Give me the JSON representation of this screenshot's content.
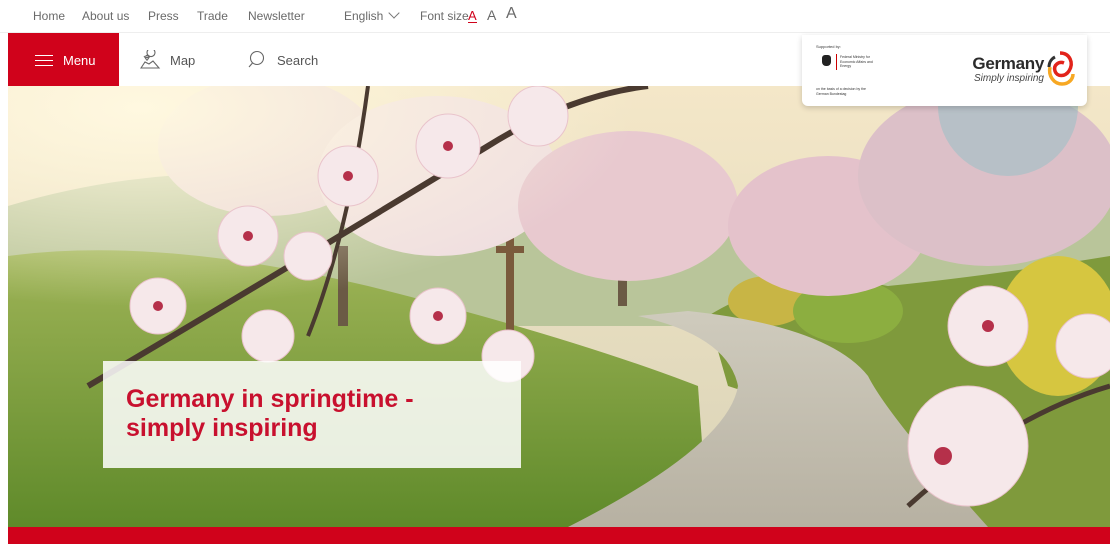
{
  "topbar": {
    "links": [
      "Home",
      "About us",
      "Press",
      "Trade",
      "Newsletter"
    ],
    "language": "English",
    "font_size_label": "Font size",
    "font_sizes": [
      "A",
      "A",
      "A"
    ]
  },
  "nav": {
    "menu_label": "Menu",
    "map_label": "Map",
    "search_label": "Search"
  },
  "logo": {
    "supported_by": "Supported by:",
    "ministry": "Federal Ministry for Economic Affairs and Energy",
    "decision": "on the basis of a decision by the German Bundestag",
    "brand_title": "Germany",
    "brand_subtitle": "Simply inspiring"
  },
  "hero": {
    "headline": "Germany in springtime -\nsimply inspiring"
  },
  "colors": {
    "accent": "#d0021b",
    "headline": "#c8102e"
  },
  "icons": {
    "menu": "hamburger-icon",
    "map": "map-icon",
    "search": "search-icon",
    "language": "chevron-down-icon",
    "logo": "swirl-logo-icon"
  }
}
